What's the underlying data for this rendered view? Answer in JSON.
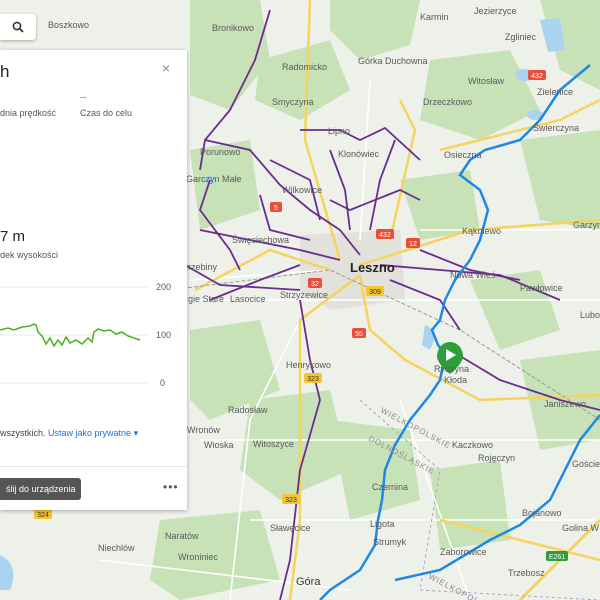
{
  "panel": {
    "title": "h",
    "close_icon": "×",
    "stat1_label": "dnia prędkość",
    "stat2_value": "--",
    "stat2_label": "Czas do celu",
    "altitude_value": "7 m",
    "altitude_label": "dek wysokości",
    "privacy_text": "wszystkich.",
    "privacy_link": "Ustaw jako prywatne",
    "privacy_caret": "▾",
    "send_button": "ślij do urządzenia",
    "more_icon": "•••"
  },
  "elevation_chart": {
    "ticks": [
      "200",
      "100",
      "0"
    ],
    "line_color": "#4caf1f"
  },
  "map": {
    "places": {
      "boszkowo": "Boszkowo",
      "bronikowo": "Bronikowo",
      "karmin": "Karmin",
      "jezierzyce": "Jezierzyce",
      "zgliniec": "Zgliniec",
      "radomicko": "Radomicko",
      "gorka_duchowna": "Górka\nDuchowna",
      "witoslaw": "Witosław",
      "smyczyna": "Smyczyna",
      "drzeczkowo": "Drzeczkowo",
      "zieleniec": "Zielenice",
      "swierczyna": "Świerczyna",
      "lipno": "Lipno",
      "porunowo": "Porunowo",
      "klonowiec": "Klonówiec",
      "osieczna": "Osieczna",
      "garczyn_male": "Garczyn Małe",
      "wilkowice": "Wilkowice",
      "swieciechowa": "Święciechowa",
      "kakolewo": "Kąkolewo",
      "garzyn": "Garzyn",
      "leszno": "Leszno",
      "grzebiny": "rzebiny",
      "nowa_wies": "Nowa Wieś",
      "pawlowice": "Pawłowice",
      "gorskie_stare": "gie Stare",
      "lasocice": "Lasocice",
      "strzyzewice": "Strzyżewice",
      "lubonia": "Lubo",
      "henrykowo": "Henrykowo",
      "rydzyna": "Rydzyna",
      "kloda": "Kłoda",
      "janiszewo": "Janiszewo",
      "radoslaw": "Radosław",
      "wronow": "Wronów",
      "wioska": "Wioska",
      "witoszyce": "Witoszyce",
      "kaczkowo": "Kaczkowo",
      "rojeczyn": "Rojęczyn",
      "goscieszyn": "Goście",
      "czernina": "Czernina",
      "slawecice": "Sławęcice",
      "ligota": "Ligota",
      "bojanowo": "Bojanowo",
      "golina_wielka": "Golina W",
      "narotow": "Naratów",
      "niechlow": "Niechlów",
      "wroniniec": "Wroniniec",
      "strumyk": "Strumyk",
      "zaborowice": "Zaborowice",
      "trzebosz": "Trzebosz",
      "gora": "Góra",
      "wielkopolskie": "WIELKOPOLSKIE",
      "dolnoslaskie": "DOLNOŚLĄSKIE",
      "wielkopol2": "WIELKOPOLSKIE"
    },
    "road_shields": [
      "432",
      "5",
      "12",
      "32",
      "309",
      "55",
      "323",
      "323",
      "324",
      "E261"
    ],
    "start_marker_color": "#2e9e3a",
    "route_color": "#1e88e5",
    "track_color": "#6a2c8e"
  }
}
